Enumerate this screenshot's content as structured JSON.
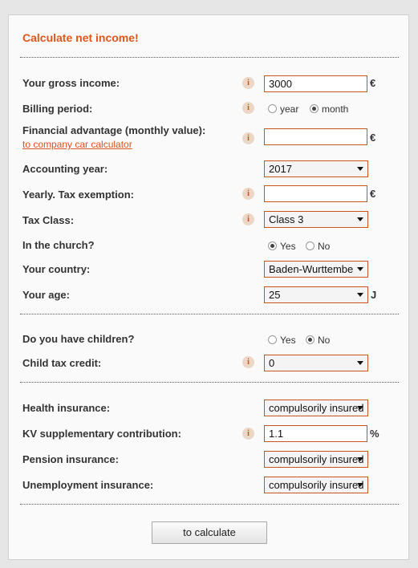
{
  "title": "Calculate net income!",
  "info_glyph": "i",
  "gross_income": {
    "label": "Your gross income:",
    "value": "3000",
    "unit": "€"
  },
  "billing_period": {
    "label": "Billing period:",
    "options": [
      "year",
      "month"
    ],
    "selected": "month"
  },
  "financial_advantage": {
    "label": "Financial advantage  (monthly value):",
    "link": "to  company car calculator",
    "value": "",
    "unit": "€"
  },
  "accounting_year": {
    "label": "Accounting year:",
    "value": "2017"
  },
  "tax_exemption": {
    "label": "Yearly. Tax exemption:",
    "value": "",
    "unit": "€"
  },
  "tax_class": {
    "label": "Tax Class:",
    "value": "Class 3"
  },
  "church": {
    "label": "In the church?",
    "options": [
      "Yes",
      "No"
    ],
    "selected": "Yes"
  },
  "country": {
    "label": "Your country:",
    "value": "Baden-Wurttembe"
  },
  "age": {
    "label": "Your age:",
    "value": "25",
    "unit": "J"
  },
  "children": {
    "label": "Do you have children?",
    "options": [
      "Yes",
      "No"
    ],
    "selected": "No"
  },
  "child_tax_credit": {
    "label": "Child tax credit:",
    "value": "0"
  },
  "health_insurance": {
    "label": "Health insurance:",
    "value": "compulsorily insured"
  },
  "kv_contribution": {
    "label": "KV supplementary contribution:",
    "value": "1.1",
    "unit": "%"
  },
  "pension_insurance": {
    "label": "Pension insurance:",
    "value": "compulsorily insured"
  },
  "unemployment_insurance": {
    "label": "Unemployment insurance:",
    "value": "compulsorily insured"
  },
  "calculate_button": "to calculate",
  "colors": {
    "accent": "#e0561a",
    "field_border": "#c8561a",
    "info_bg": "#ead7c7"
  }
}
